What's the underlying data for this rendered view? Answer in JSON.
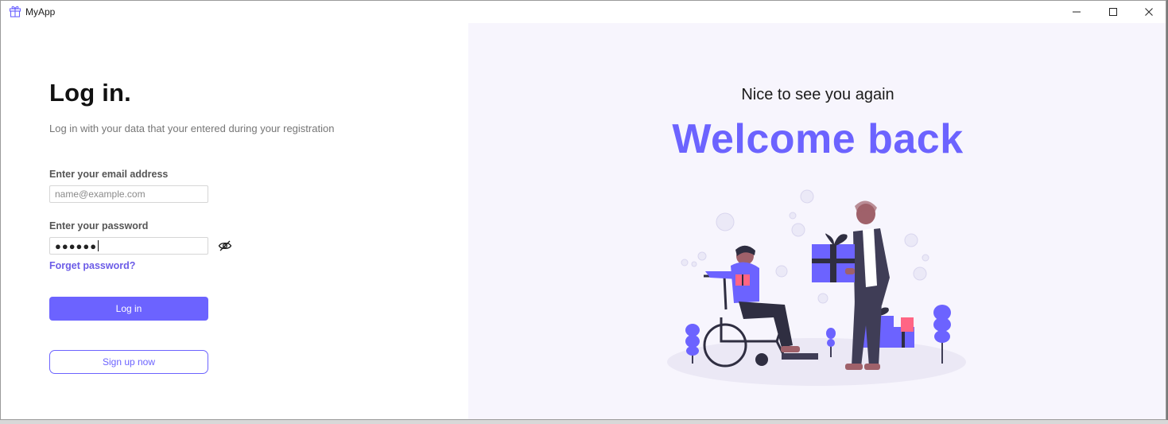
{
  "titlebar": {
    "app_title": "MyApp",
    "app_icon": "gift-icon",
    "controls": [
      "minimize-icon",
      "maximize-icon",
      "close-icon"
    ]
  },
  "login": {
    "title": "Log in.",
    "subtitle": "Log in with your data that your entered during your registration",
    "email_label": "Enter your email address",
    "email_placeholder": "name@example.com",
    "email_value": "",
    "password_label": "Enter your password",
    "password_value": "●●●●●●",
    "password_toggle_icon": "eye-hidden-icon",
    "forget_link": "Forget password?",
    "login_button": "Log in",
    "signup_button": "Sign up now"
  },
  "welcome": {
    "greeting": "Nice to see you again",
    "title": "Welcome back",
    "illustration": "gift-giving-illustration"
  },
  "colors": {
    "accent": "#6c63ff",
    "right_panel_bg": "#f7f5fd",
    "text_dark": "#111111",
    "text_muted": "#767676"
  }
}
